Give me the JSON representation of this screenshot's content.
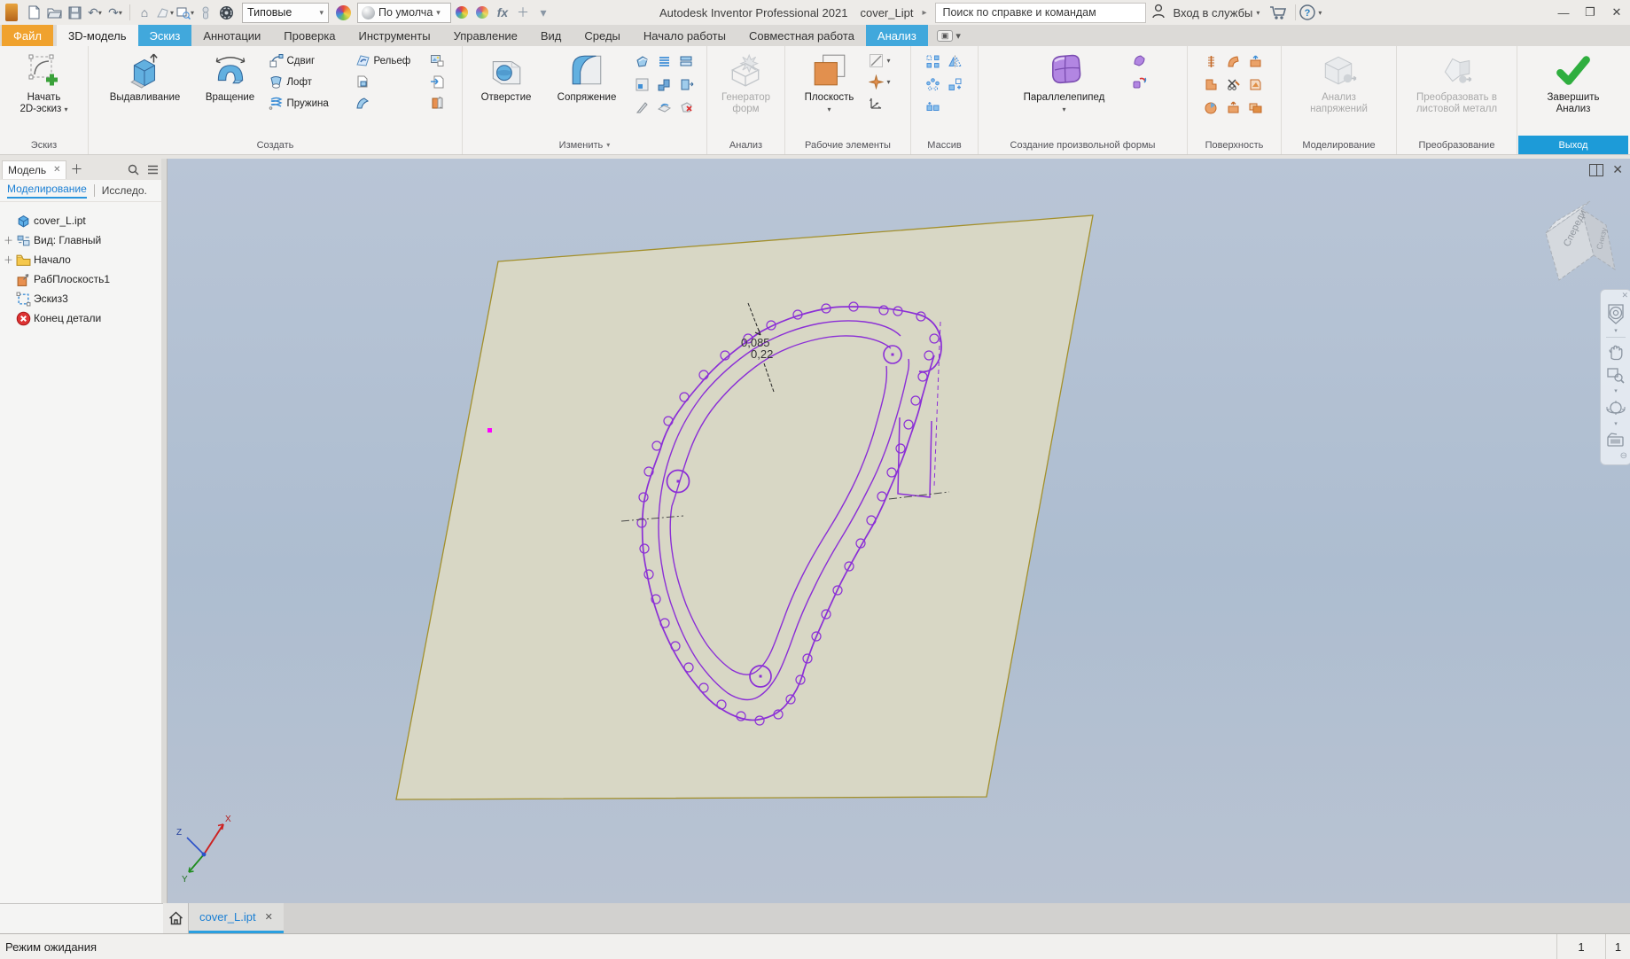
{
  "titlebar": {
    "style_combo": "Типовые",
    "appearance_combo": "По умолча",
    "app_title": "Autodesk Inventor Professional 2021",
    "doc_title": "cover_Lipt",
    "search_placeholder": "Поиск по справке и командам",
    "signin_label": "Вход в службы"
  },
  "tabs": [
    {
      "label": "Файл",
      "style": "file"
    },
    {
      "label": "3D-модель",
      "style": "active"
    },
    {
      "label": "Эскиз",
      "style": "context"
    },
    {
      "label": "Аннотации",
      "style": "normal"
    },
    {
      "label": "Проверка",
      "style": "normal"
    },
    {
      "label": "Инструменты",
      "style": "normal"
    },
    {
      "label": "Управление",
      "style": "normal"
    },
    {
      "label": "Вид",
      "style": "normal"
    },
    {
      "label": "Среды",
      "style": "normal"
    },
    {
      "label": "Начало работы",
      "style": "normal"
    },
    {
      "label": "Совместная работа",
      "style": "normal"
    },
    {
      "label": "Анализ",
      "style": "context"
    }
  ],
  "ribbon": {
    "groups": [
      {
        "label": "Эскиз",
        "start2d_line1": "Начать",
        "start2d_line2": "2D-эскиз"
      },
      {
        "label": "Создать",
        "extrude": "Выдавливание",
        "revolve": "Вращение",
        "sweep": "Сдвиг",
        "loft": "Лофт",
        "coil": "Пружина",
        "emboss": "Рельеф"
      },
      {
        "label": "Изменить",
        "hole": "Отверстие",
        "fillet": "Сопряжение"
      },
      {
        "label": "Анализ",
        "shapegen_line1": "Генератор",
        "shapegen_line2": "форм"
      },
      {
        "label": "Рабочие элементы",
        "plane": "Плоскость"
      },
      {
        "label": "Массив"
      },
      {
        "label": "Создание произвольной формы",
        "box": "Параллелепипед"
      },
      {
        "label": "Поверхность"
      },
      {
        "label": "Моделирование",
        "stress_line1": "Анализ",
        "stress_line2": "напряжений"
      },
      {
        "label": "Преобразование",
        "convert_line1": "Преобразовать в",
        "convert_line2": "листовой металл"
      },
      {
        "label": "Выход",
        "finish_line1": "Завершить",
        "finish_line2": "Анализ"
      }
    ]
  },
  "browser": {
    "panel_tab": "Модель",
    "subtab_active": "Моделирование",
    "subtab_other": "Исследо.",
    "tree": [
      {
        "label": "cover_L.ipt",
        "icon": "part",
        "expandable": false
      },
      {
        "label": "Вид: Главный",
        "icon": "view",
        "expandable": true
      },
      {
        "label": "Начало",
        "icon": "folder",
        "expandable": true
      },
      {
        "label": "РабПлоскость1",
        "icon": "workplane",
        "expandable": false
      },
      {
        "label": "Эскиз3",
        "icon": "sketch",
        "expandable": false
      },
      {
        "label": "Конец детали",
        "icon": "eop",
        "expandable": false
      }
    ]
  },
  "canvas": {
    "dim_primary": "0,085",
    "dim_secondary": "0,22",
    "viewcube_face_front": "Спереди",
    "viewcube_face_side": "Снизу",
    "triad_x": "X",
    "triad_y": "Y",
    "triad_z": "Z"
  },
  "doctab": {
    "label": "cover_L.ipt"
  },
  "statusbar": {
    "message": "Режим ожидания",
    "counter_a": "1",
    "counter_b": "1"
  },
  "colors": {
    "accent_blue": "#41a8dc",
    "file_orange": "#f0a22e",
    "sketch_purple": "#8b2fd6",
    "plane_fill": "#d8d7c5",
    "plane_edge": "#a3902c",
    "exit_label_blue": "#1d9bd8"
  }
}
